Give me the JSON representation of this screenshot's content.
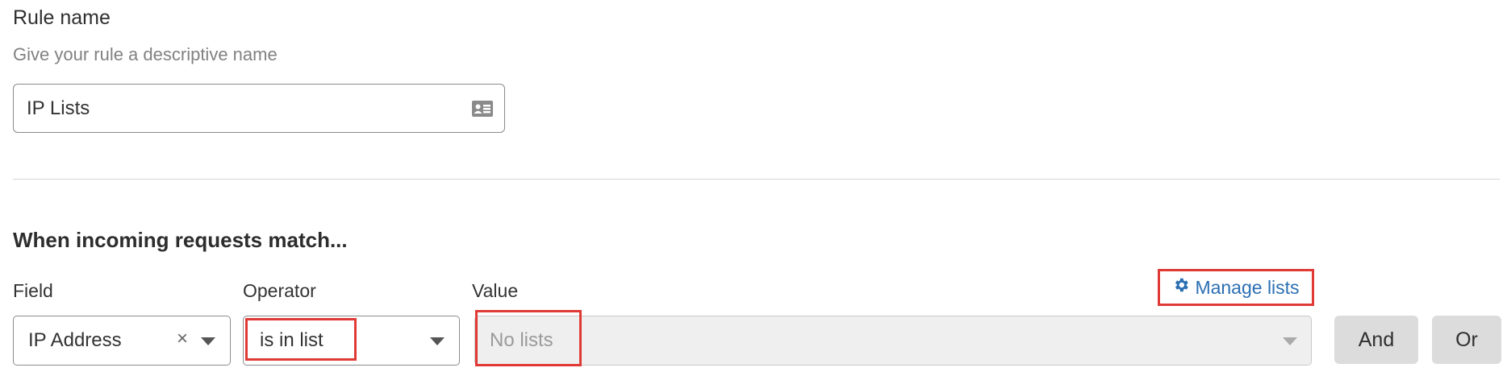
{
  "rule_name": {
    "title": "Rule name",
    "subtitle": "Give your rule a descriptive name",
    "value": "IP Lists",
    "icon": "id-card-icon"
  },
  "match": {
    "heading": "When incoming requests match...",
    "field_label": "Field",
    "operator_label": "Operator",
    "value_label": "Value",
    "manage_lists": "Manage lists",
    "manage_icon": "gear-icon",
    "field_value": "IP Address",
    "clear_symbol": "×",
    "operator_value": "is in list",
    "value_placeholder": "No lists",
    "and_label": "And",
    "or_label": "Or"
  },
  "colors": {
    "link": "#2b6fb3",
    "highlight": "#e03a36",
    "button_bg": "#dcdcdc"
  }
}
